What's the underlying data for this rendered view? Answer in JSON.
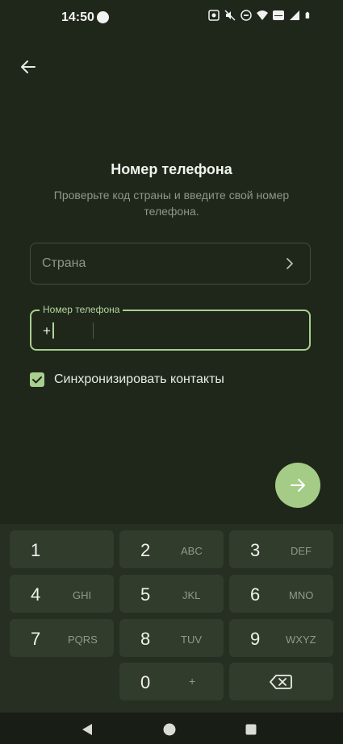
{
  "status_bar": {
    "time": "14:50",
    "icons": [
      "screen-record-icon",
      "mute-icon",
      "dnd-icon",
      "wifi-icon",
      "volte-icon",
      "signal-icon",
      "battery-icon"
    ]
  },
  "header": {
    "back_icon": "arrow-left-icon"
  },
  "main": {
    "title": "Номер телефона",
    "subtitle": "Проверьте код страны и введите свой номер телефона.",
    "country_field": {
      "placeholder": "Страна",
      "icon": "chevron-right-icon"
    },
    "phone_field": {
      "label": "Номер телефона",
      "prefix": "+",
      "value": ""
    },
    "sync_contacts": {
      "label": "Синхронизировать контакты",
      "checked": true
    },
    "next_button_icon": "arrow-right-icon"
  },
  "keypad": {
    "keys": [
      {
        "digit": "1",
        "letters": ""
      },
      {
        "digit": "2",
        "letters": "ABC"
      },
      {
        "digit": "3",
        "letters": "DEF"
      },
      {
        "digit": "4",
        "letters": "GHI"
      },
      {
        "digit": "5",
        "letters": "JKL"
      },
      {
        "digit": "6",
        "letters": "MNO"
      },
      {
        "digit": "7",
        "letters": "PQRS"
      },
      {
        "digit": "8",
        "letters": "TUV"
      },
      {
        "digit": "9",
        "letters": "WXYZ"
      },
      {
        "digit": "0",
        "letters": "+"
      }
    ],
    "backspace_icon": "backspace-icon"
  },
  "nav_bar": {
    "icons": [
      "back-triangle-icon",
      "home-circle-icon",
      "recents-square-icon"
    ]
  },
  "colors": {
    "background": "#1f271b",
    "accent": "#a9cf8e",
    "muted_text": "#8d9886",
    "key_bg": "#323c2d"
  }
}
